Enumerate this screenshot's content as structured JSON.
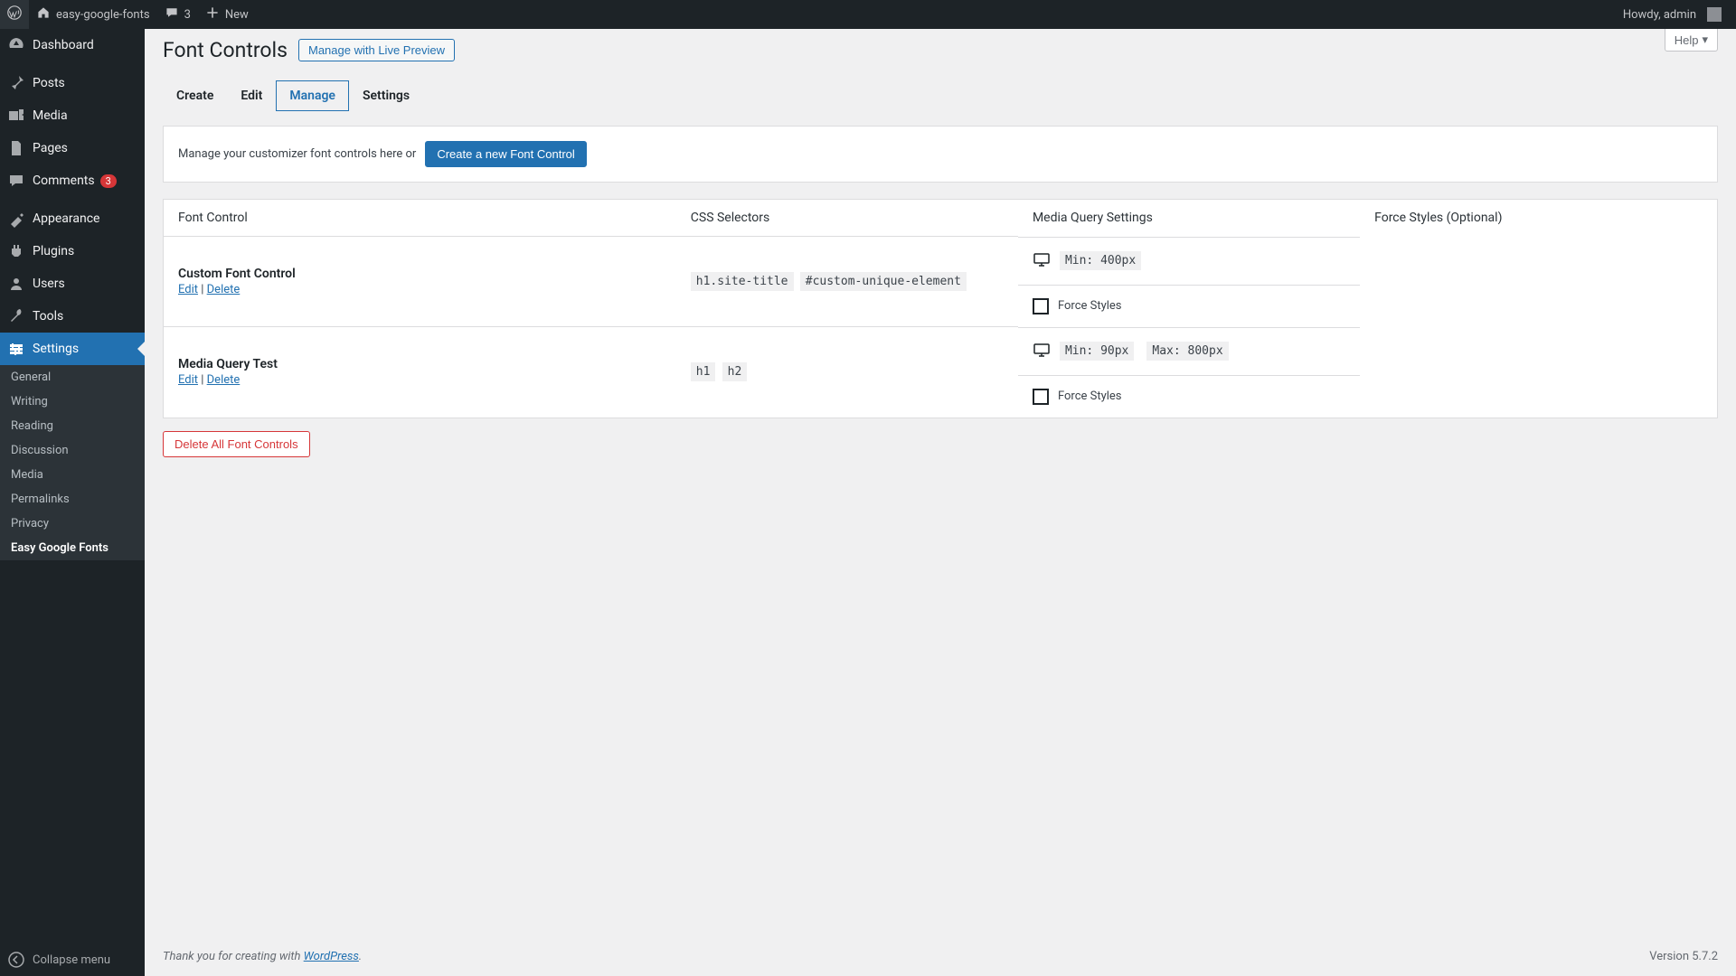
{
  "adminbar": {
    "site_name": "easy-google-fonts",
    "comment_count": "3",
    "new_label": "New",
    "howdy": "Howdy, admin"
  },
  "sidebar": {
    "items": [
      {
        "label": "Dashboard"
      },
      {
        "label": "Posts"
      },
      {
        "label": "Media"
      },
      {
        "label": "Pages"
      },
      {
        "label": "Comments",
        "badge": "3"
      },
      {
        "label": "Appearance"
      },
      {
        "label": "Plugins"
      },
      {
        "label": "Users"
      },
      {
        "label": "Tools"
      },
      {
        "label": "Settings"
      }
    ],
    "submenu": [
      {
        "label": "General"
      },
      {
        "label": "Writing"
      },
      {
        "label": "Reading"
      },
      {
        "label": "Discussion"
      },
      {
        "label": "Media"
      },
      {
        "label": "Permalinks"
      },
      {
        "label": "Privacy"
      },
      {
        "label": "Easy Google Fonts"
      }
    ],
    "collapse": "Collapse menu"
  },
  "page": {
    "title": "Font Controls",
    "live_preview_btn": "Manage with Live Preview",
    "help_btn": "Help",
    "tabs": [
      "Create",
      "Edit",
      "Manage",
      "Settings"
    ],
    "notice_text": "Manage your customizer font controls here or",
    "create_btn": "Create a new Font Control",
    "delete_all_btn": "Delete All Font Controls",
    "columns": {
      "font_control": "Font Control",
      "css_selectors": "CSS Selectors",
      "media_query": "Media Query Settings",
      "force_styles": "Force Styles (Optional)"
    },
    "row_actions": {
      "edit": "Edit",
      "sep": " | ",
      "delete": "Delete"
    },
    "force_styles_label": "Force Styles",
    "rows": [
      {
        "title": "Custom Font Control",
        "selectors": [
          "h1.site-title",
          "#custom-unique-element"
        ],
        "mq": [
          "Min: 400px"
        ]
      },
      {
        "title": "Media Query Test",
        "selectors": [
          "h1",
          "h2"
        ],
        "mq": [
          "Min: 90px",
          "Max: 800px"
        ]
      }
    ]
  },
  "footer": {
    "thanks_prefix": "Thank you for creating with ",
    "wp": "WordPress",
    "period": ".",
    "version": "Version 5.7.2"
  }
}
